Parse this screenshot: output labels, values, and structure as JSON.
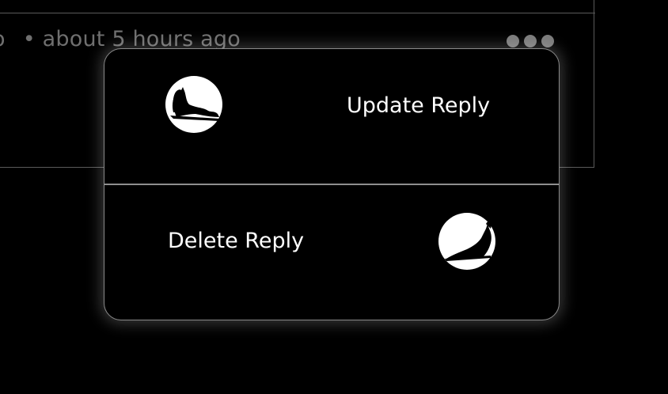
{
  "background_reply": {
    "meta_cut": "o",
    "meta_time": "• about 5 hours ago"
  },
  "menu": {
    "items": [
      {
        "label": "Update Reply",
        "icon": "cat-stretch-icon"
      },
      {
        "label": "Delete Reply",
        "icon": "cat-stretch-icon"
      }
    ]
  }
}
